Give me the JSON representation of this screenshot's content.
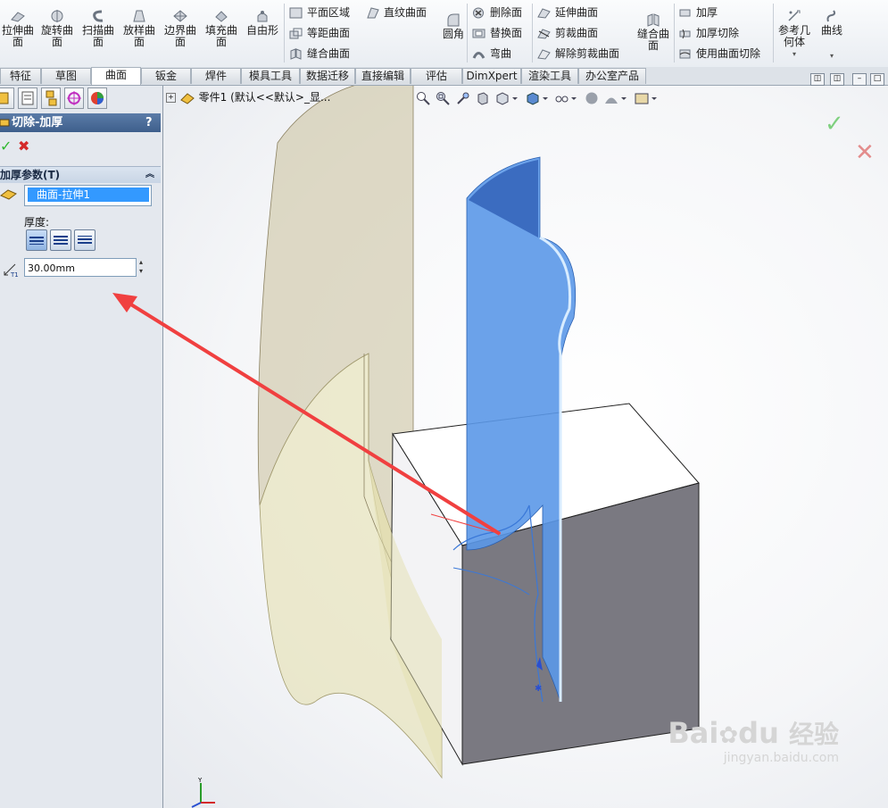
{
  "ribbon": {
    "large_buttons": [
      {
        "label": "拉伸曲\n面",
        "icon": "extruded-surface-icon"
      },
      {
        "label": "旋转曲\n面",
        "icon": "revolved-surface-icon"
      },
      {
        "label": "扫描曲\n面",
        "icon": "swept-surface-icon"
      },
      {
        "label": "放样曲\n面",
        "icon": "lofted-surface-icon"
      },
      {
        "label": "边界曲\n面",
        "icon": "boundary-surface-icon"
      },
      {
        "label": "填充曲\n面",
        "icon": "filled-surface-icon"
      },
      {
        "label": "自由形",
        "icon": "freeform-icon"
      }
    ],
    "col1": [
      "平面区域",
      "等距曲面",
      "缝合曲面"
    ],
    "col2": [
      "直纹曲面"
    ],
    "fillet": "圆角",
    "col3": [
      "删除面",
      "替换面",
      "弯曲"
    ],
    "col4": [
      "延伸曲面",
      "剪裁曲面",
      "解除剪裁曲面"
    ],
    "knit": "缝合曲\n面",
    "col5": [
      "加厚",
      "加厚切除",
      "使用曲面切除"
    ],
    "ref_geometry": "参考几\n何体",
    "curves": "曲线"
  },
  "tabs": [
    "特征",
    "草图",
    "曲面",
    "钣金",
    "焊件",
    "模具工具",
    "数据迁移",
    "直接编辑",
    "评估",
    "DimXpert",
    "渲染工具",
    "办公室产品"
  ],
  "active_tab": "曲面",
  "panel": {
    "title": "切除-加厚",
    "help": "?",
    "group_title": "加厚参数(T)",
    "face": "曲面-拉伸1",
    "thickness_label": "厚度:",
    "thickness_value": "30.00mm"
  },
  "tree": {
    "node": "零件1 (默认<<默认>_显..."
  },
  "colors": {
    "accent": "#3399ff",
    "ok": "#2eb82e",
    "cancel": "#d42a2a",
    "arrow": "#f04040"
  },
  "watermark": {
    "brand": "Bai",
    "brand2": "du",
    "cn": "经验",
    "url": "jingyan.baidu.com"
  }
}
